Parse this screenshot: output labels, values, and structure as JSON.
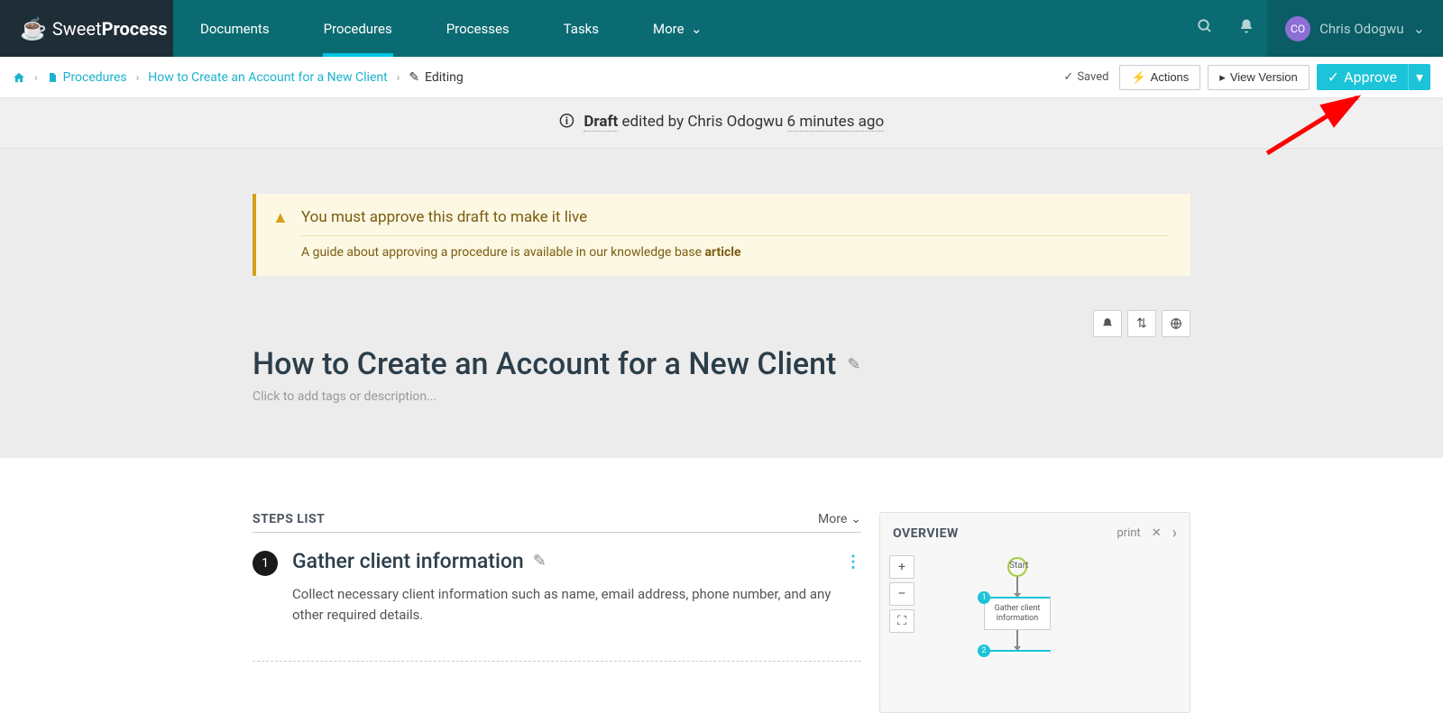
{
  "brand": {
    "name1": "Sweet",
    "name2": "Process"
  },
  "nav": {
    "documents": "Documents",
    "procedures": "Procedures",
    "processes": "Processes",
    "tasks": "Tasks",
    "more": "More"
  },
  "user": {
    "initials": "CO",
    "name": "Chris Odogwu"
  },
  "breadcrumb": {
    "procedures": "Procedures",
    "doc": "How to Create an Account for a New Client",
    "editing": "Editing"
  },
  "toolbar": {
    "saved": "Saved",
    "actions": "Actions",
    "view_version": "View Version",
    "approve": "Approve"
  },
  "draftbar": {
    "prefix": "Draft",
    "mid": " edited by Chris Odogwu ",
    "time": "6 minutes ago"
  },
  "alert": {
    "title": "You must approve this draft to make it live",
    "sub_prefix": "A guide about approving a procedure is available in our knowledge base ",
    "sub_link": "article"
  },
  "doc": {
    "title": "How to Create an Account for a New Client",
    "placeholder": "Click to add tags or description..."
  },
  "steps": {
    "header": "STEPS LIST",
    "more": "More",
    "step1": {
      "num": "1",
      "title": "Gather client information",
      "desc": "Collect necessary client information such as name, email address, phone number, and any other required details."
    }
  },
  "overview": {
    "title": "OVERVIEW",
    "print": "print",
    "start": "Start",
    "node1": "Gather client information",
    "badge1": "1",
    "badge2": "2",
    "zoom_in": "+",
    "zoom_out": "–",
    "fullscreen": "⛶",
    "expand_x": "✕",
    "chevron": "›"
  }
}
